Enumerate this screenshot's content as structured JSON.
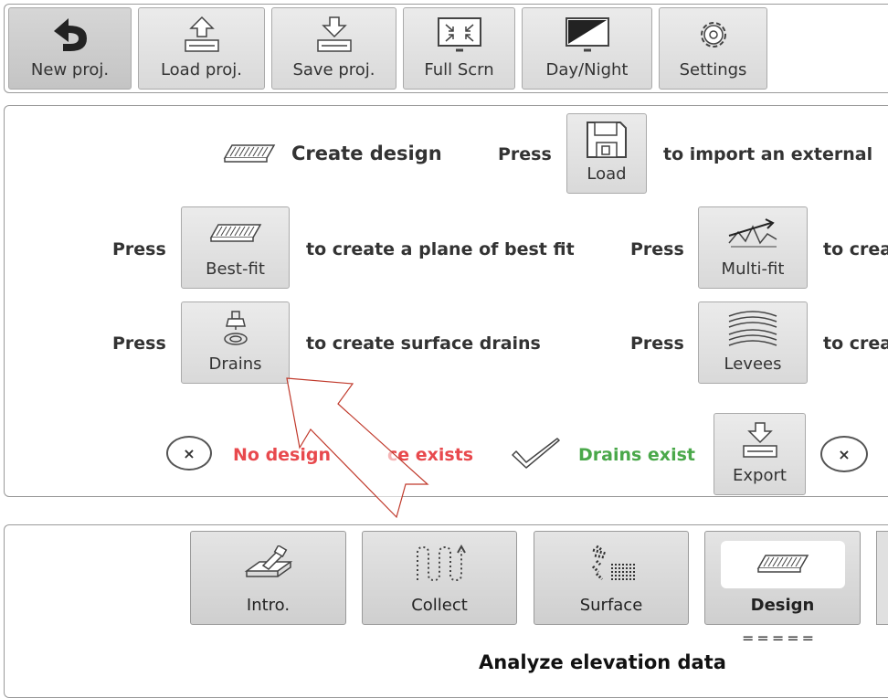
{
  "toolbar": {
    "items": [
      {
        "label": "New proj.",
        "icon": "undo-arrow-icon"
      },
      {
        "label": "Load proj.",
        "icon": "load-icon"
      },
      {
        "label": "Save proj.",
        "icon": "save-icon"
      },
      {
        "label": "Full Scrn",
        "icon": "fullscreen-icon"
      },
      {
        "label": "Day/Night",
        "icon": "day-night-icon"
      },
      {
        "label": "Settings",
        "icon": "gear-icon"
      }
    ]
  },
  "design": {
    "title": "Create design",
    "press": "Press",
    "load_label": "Load",
    "import_text": "to import an external",
    "bestfit_label": "Best-fit",
    "bestfit_text": "to create a plane of best fit",
    "multifit_label": "Multi-fit",
    "multifit_text": "to crea",
    "drains_label": "Drains",
    "drains_text": "to create surface drains",
    "levees_label": "Levees",
    "levees_text": "to crea",
    "status_no_design_left": "No design",
    "status_no_design_right": "ce exists",
    "status_drains": "Drains exist",
    "export_label": "Export",
    "x_mark": "×"
  },
  "nav": {
    "items": [
      {
        "label": "Intro.",
        "icon": "survey-icon"
      },
      {
        "label": "Collect",
        "icon": "collect-path-icon"
      },
      {
        "label": "Surface",
        "icon": "surface-grid-icon"
      },
      {
        "label": "Design",
        "icon": "design-plane-icon"
      }
    ],
    "underline": "=====",
    "footer": "Analyze elevation data"
  },
  "colors": {
    "red": "#e8494d",
    "green": "#4aa84a",
    "button_bg": "#dedede"
  }
}
